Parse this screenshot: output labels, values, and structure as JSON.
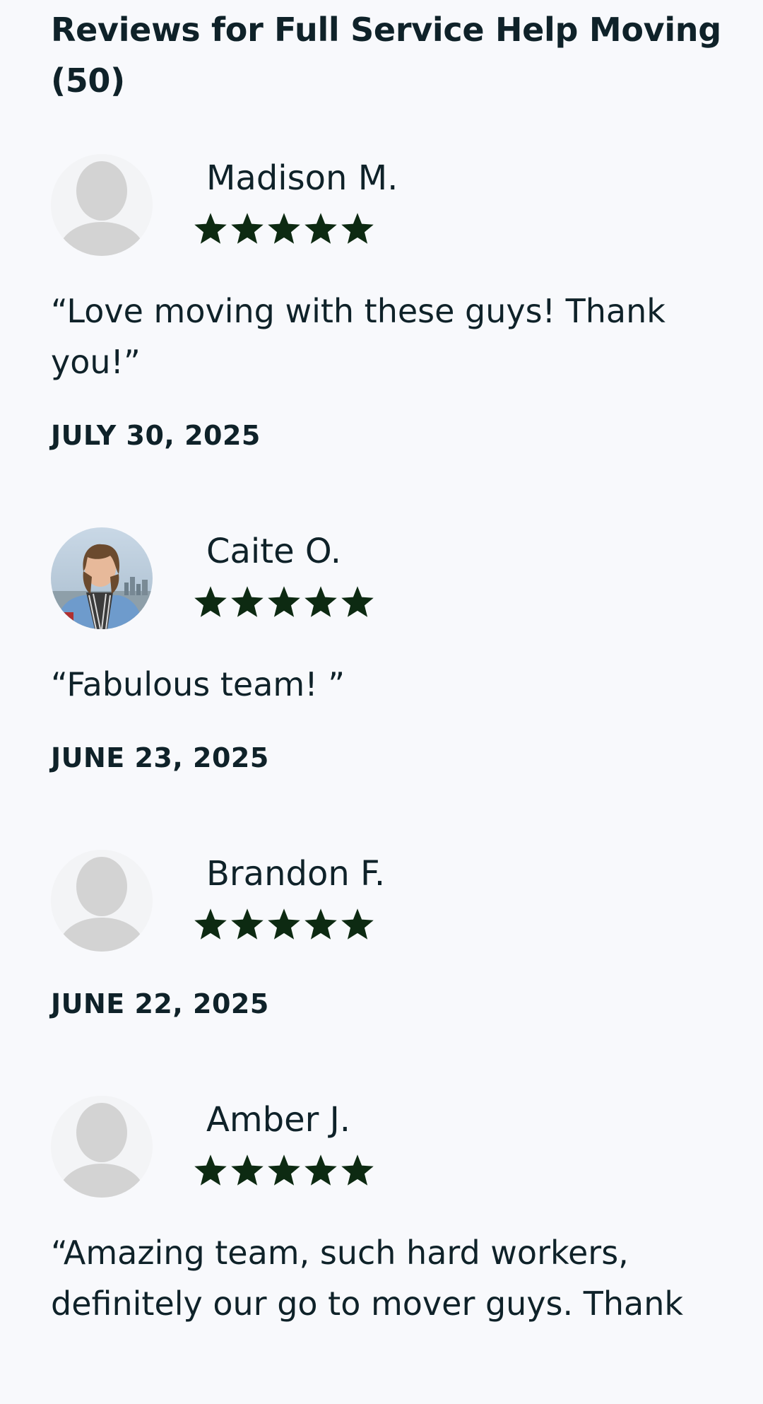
{
  "heading": "Reviews for Full Service Help Moving (50)",
  "colors": {
    "background": "#f8f9fc",
    "text": "#0f2229",
    "star": "#0d2a12",
    "avatar_placeholder": "#d3d3d3"
  },
  "reviews": [
    {
      "name": "Madison M.",
      "rating": 5,
      "avatar": "default-avatar-icon",
      "quote": "“Love moving with these guys! Thank you!”",
      "date": "JULY 30, 2025"
    },
    {
      "name": "Caite O.",
      "rating": 5,
      "avatar": "user-photo",
      "quote": "“Fabulous team! ”",
      "date": "JUNE 23, 2025"
    },
    {
      "name": "Brandon F.",
      "rating": 5,
      "avatar": "default-avatar-icon",
      "quote": "",
      "date": "JUNE 22, 2025"
    },
    {
      "name": "Amber J.",
      "rating": 5,
      "avatar": "default-avatar-icon",
      "quote": "“Amazing team, such hard workers, definitely our go to mover guys. Thank",
      "date": ""
    }
  ]
}
